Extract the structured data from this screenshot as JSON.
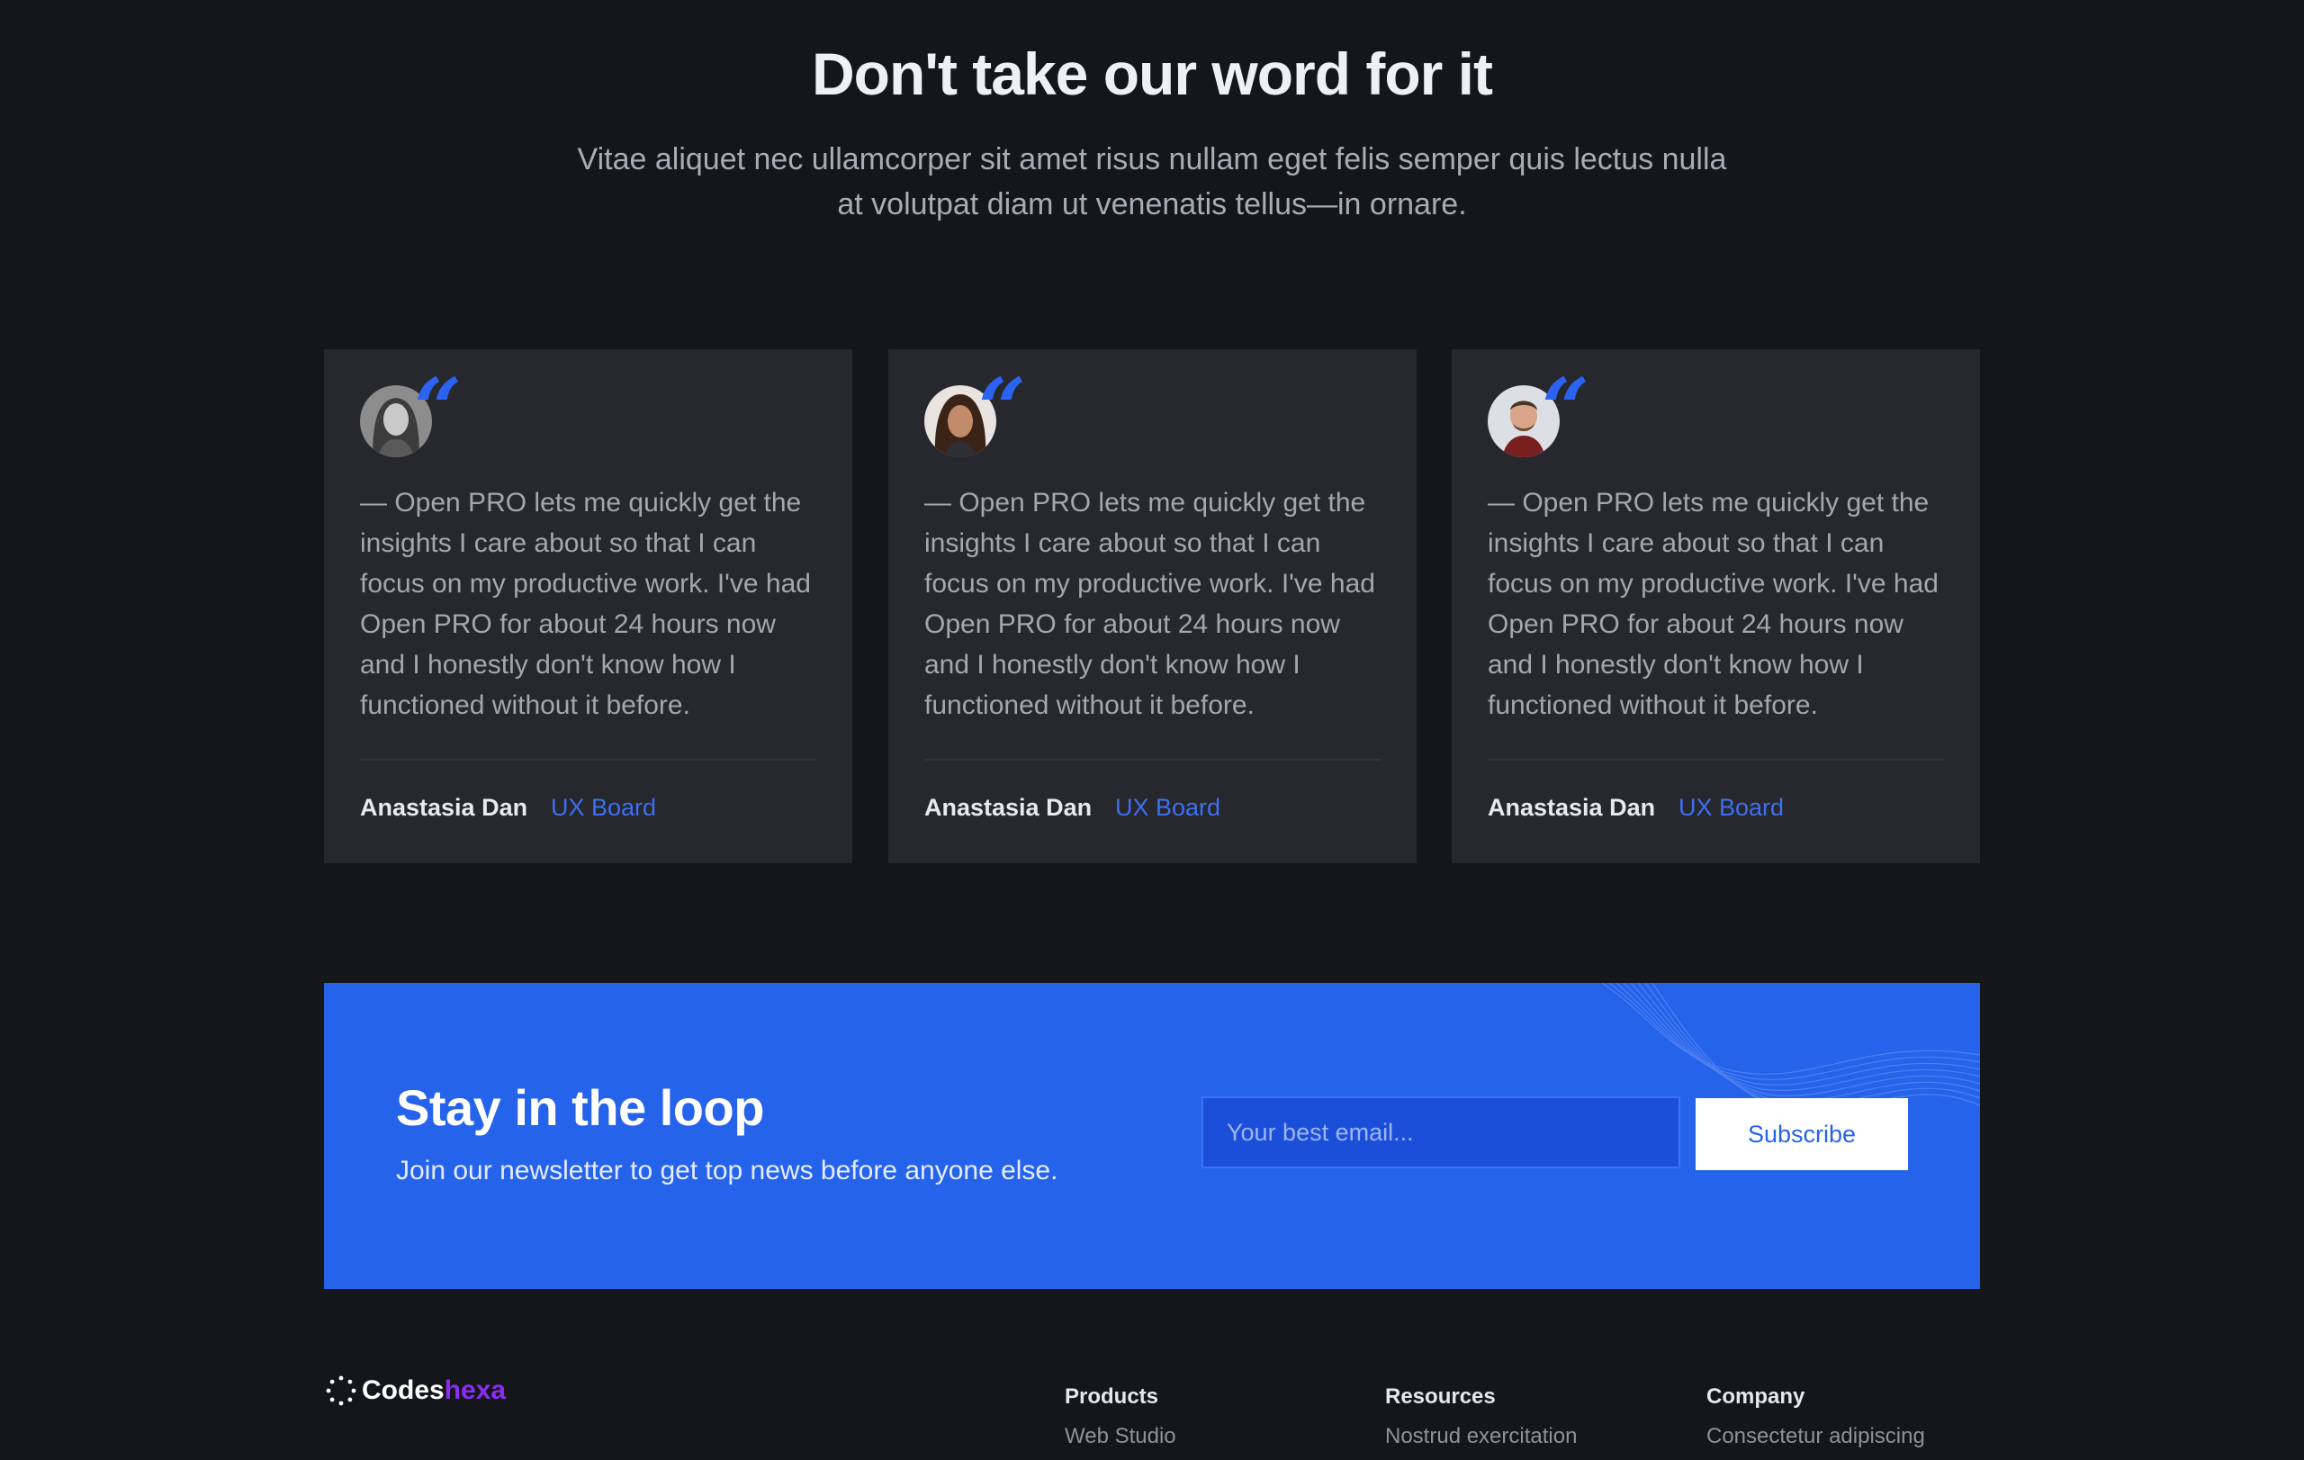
{
  "section": {
    "title": "Don't take our word for it",
    "subtitle": "Vitae aliquet nec ullamcorper sit amet risus nullam eget felis semper quis lectus nulla at volutpat diam ut venenatis tellus—in ornare."
  },
  "testimonials": [
    {
      "quote": "— Open PRO lets me quickly get the insights I care about so that I can focus on my productive work. I've had Open PRO for about 24 hours now and I honestly don't know how I functioned without it before.",
      "author": "Anastasia Dan",
      "role": "UX Board",
      "avatar_icon": "avatar-woman-grayscale"
    },
    {
      "quote": "— Open PRO lets me quickly get the insights I care about so that I can focus on my productive work. I've had Open PRO for about 24 hours now and I honestly don't know how I functioned without it before.",
      "author": "Anastasia Dan",
      "role": "UX Board",
      "avatar_icon": "avatar-man-curly-hair"
    },
    {
      "quote": "— Open PRO lets me quickly get the insights I care about so that I can focus on my productive work. I've had Open PRO for about 24 hours now and I honestly don't know how I functioned without it before.",
      "author": "Anastasia Dan",
      "role": "UX Board",
      "avatar_icon": "avatar-man-beard"
    }
  ],
  "newsletter": {
    "title": "Stay in the loop",
    "subtitle": "Join our newsletter to get top news before anyone else.",
    "email_placeholder": "Your best email...",
    "subscribe_label": "Subscribe"
  },
  "footer": {
    "logo_main": "Codes",
    "logo_accent": "hexa",
    "columns": [
      {
        "title": "Products",
        "link": "Web Studio"
      },
      {
        "title": "Resources",
        "link": "Nostrud exercitation"
      },
      {
        "title": "Company",
        "link": "Consectetur adipiscing"
      }
    ]
  },
  "colors": {
    "background": "#151619",
    "card": "#26282d",
    "accent_blue": "#2563ea",
    "logo_accent": "#8b2cf5"
  }
}
